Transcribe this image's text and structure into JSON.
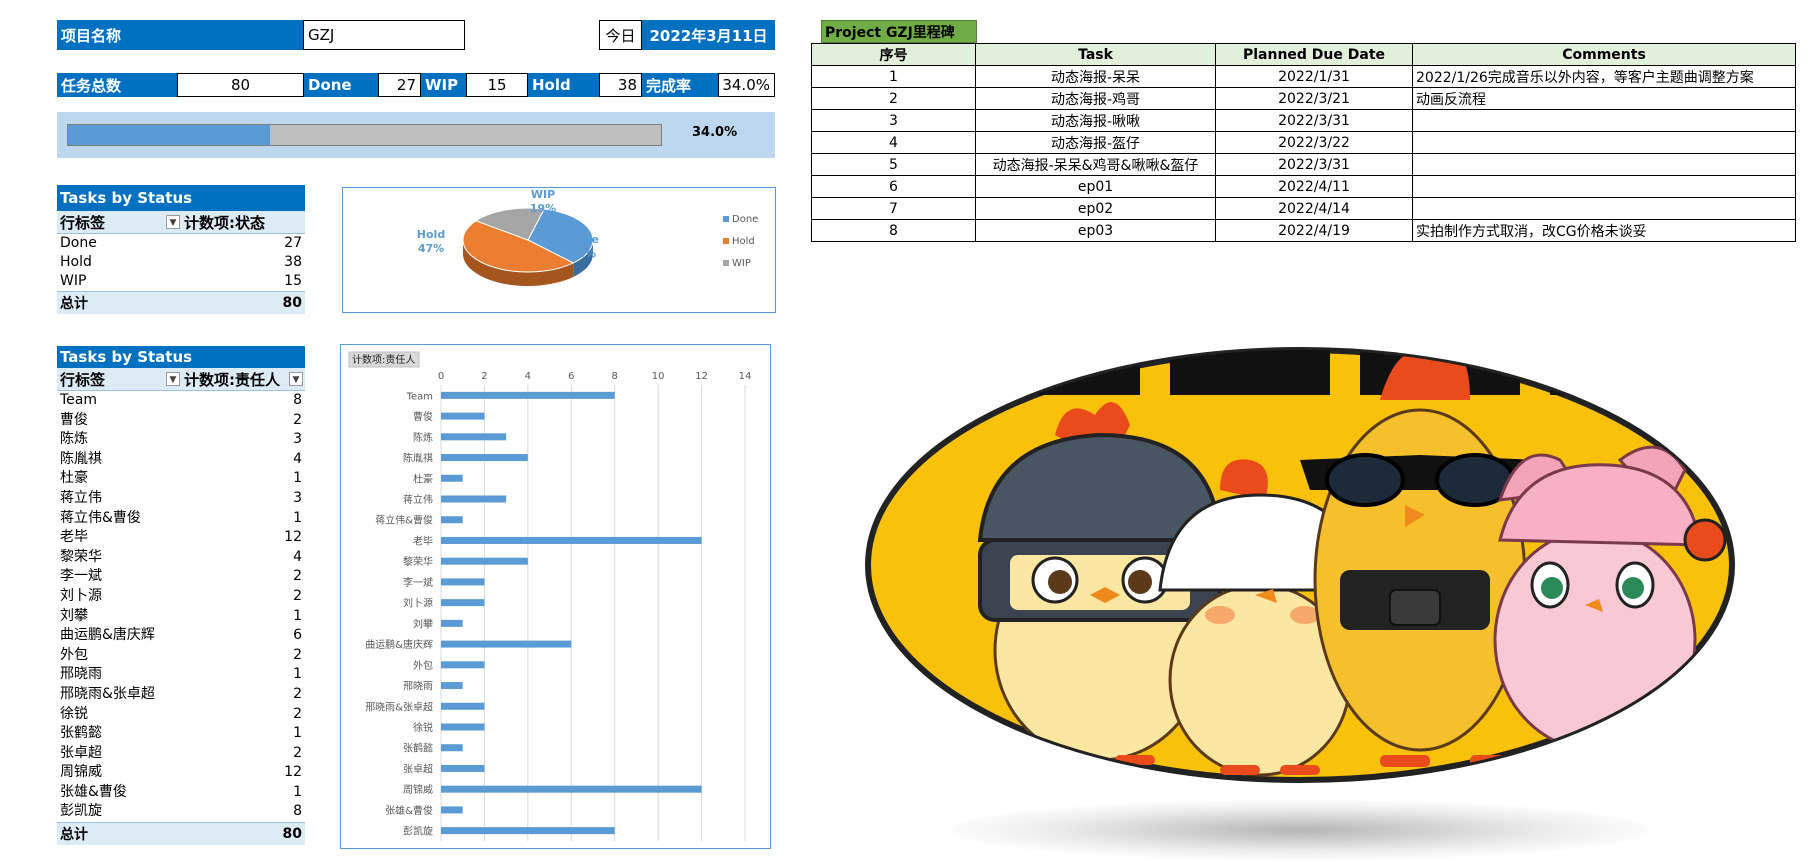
{
  "project": {
    "name_label": "项目名称",
    "name_value": "GZJ",
    "today_label": "今日",
    "today_value": "2022年3月11日"
  },
  "summary": {
    "total_label": "任务总数",
    "total_value": "80",
    "done_label": "Done",
    "done_value": "27",
    "wip_label": "WIP",
    "wip_value": "15",
    "hold_label": "Hold",
    "hold_value": "38",
    "rate_label": "完成率",
    "rate_value": "34.0%"
  },
  "progress": {
    "fraction": 0.34,
    "label": "34.0%"
  },
  "status_pivot": {
    "title": "Tasks by Status",
    "col1": "行标签",
    "col2": "计数项:状态",
    "rows": [
      {
        "label": "Done",
        "value": "27"
      },
      {
        "label": "Hold",
        "value": "38"
      },
      {
        "label": "WIP",
        "value": "15"
      }
    ],
    "total_label": "总计",
    "total_value": "80"
  },
  "owner_pivot": {
    "title": "Tasks by Status",
    "col1": "行标签",
    "col2": "计数项:责任人",
    "rows": [
      {
        "label": "Team",
        "value": "8"
      },
      {
        "label": "曹俊",
        "value": "2"
      },
      {
        "label": "陈炼",
        "value": "3"
      },
      {
        "label": "陈胤祺",
        "value": "4"
      },
      {
        "label": "杜豪",
        "value": "1"
      },
      {
        "label": "蒋立伟",
        "value": "3"
      },
      {
        "label": "蒋立伟&曹俊",
        "value": "1"
      },
      {
        "label": "老毕",
        "value": "12"
      },
      {
        "label": "黎荣华",
        "value": "4"
      },
      {
        "label": "李一斌",
        "value": "2"
      },
      {
        "label": "刘卜源",
        "value": "2"
      },
      {
        "label": "刘攀",
        "value": "1"
      },
      {
        "label": "曲运鹏&唐庆辉",
        "value": "6"
      },
      {
        "label": "外包",
        "value": "2"
      },
      {
        "label": "邢晓雨",
        "value": "1"
      },
      {
        "label": "邢晓雨&张卓超",
        "value": "2"
      },
      {
        "label": "徐锐",
        "value": "2"
      },
      {
        "label": "张鹤懿",
        "value": "1"
      },
      {
        "label": "张卓超",
        "value": "2"
      },
      {
        "label": "周锦威",
        "value": "12"
      },
      {
        "label": "张雄&曹俊",
        "value": "1"
      },
      {
        "label": "彭凯旋",
        "value": "8"
      }
    ],
    "total_label": "总计",
    "total_value": "80"
  },
  "chart_data": [
    {
      "type": "pie",
      "categories": [
        "Done",
        "Hold",
        "WIP"
      ],
      "values": [
        27,
        38,
        15
      ],
      "labels": [
        "Done\n34%",
        "Hold\n47%",
        "WIP\n19%"
      ],
      "legend": [
        "Done",
        "Hold",
        "WIP"
      ],
      "legend_position": "right",
      "colors": [
        "#5b9bd5",
        "#ed7d31",
        "#a5a5a5"
      ]
    },
    {
      "type": "bar",
      "orientation": "horizontal",
      "field_button": "计数项:责任人",
      "categories": [
        "Team",
        "曹俊",
        "陈炼",
        "陈胤祺",
        "杜豪",
        "蒋立伟",
        "蒋立伟&曹俊",
        "老毕",
        "黎荣华",
        "李一斌",
        "刘卜源",
        "刘攀",
        "曲运鹏&唐庆辉",
        "外包",
        "邢晓雨",
        "邢晓雨&张卓超",
        "徐锐",
        "张鹤懿",
        "张卓超",
        "周锦威",
        "张雄&曹俊",
        "彭凯旋"
      ],
      "values": [
        8,
        2,
        3,
        4,
        1,
        3,
        1,
        12,
        4,
        2,
        2,
        1,
        6,
        2,
        1,
        2,
        2,
        1,
        2,
        12,
        1,
        8
      ],
      "xlim": [
        0,
        14
      ],
      "xticks": [
        "0",
        "2",
        "4",
        "6",
        "8",
        "10",
        "12",
        "14"
      ],
      "grid": true,
      "color": "#5b9bd5"
    }
  ],
  "milestones": {
    "title": "Project GZJ里程碑",
    "headers": [
      "序号",
      "Task",
      "Planned Due Date",
      "Comments"
    ],
    "rows": [
      [
        "1",
        "动态海报-呆呆",
        "2022/1/31",
        "2022/1/26完成音乐以外内容，等客户主题曲调整方案"
      ],
      [
        "2",
        "动态海报-鸡哥",
        "2022/3/21",
        "动画反流程"
      ],
      [
        "3",
        "动态海报-啾啾",
        "2022/3/31",
        ""
      ],
      [
        "4",
        "动态海报-盔仔",
        "2022/3/22",
        ""
      ],
      [
        "5",
        "动态海报-呆呆&鸡哥&啾啾&盔仔",
        "2022/3/31",
        ""
      ],
      [
        "6",
        "ep01",
        "2022/4/11",
        ""
      ],
      [
        "7",
        "ep02",
        "2022/4/14",
        ""
      ],
      [
        "8",
        "ep03",
        "2022/4/19",
        "实拍制作方式取消，改CG价格未谈妥"
      ]
    ]
  },
  "image": {
    "icon": "cartoon-chickens-illustration"
  }
}
